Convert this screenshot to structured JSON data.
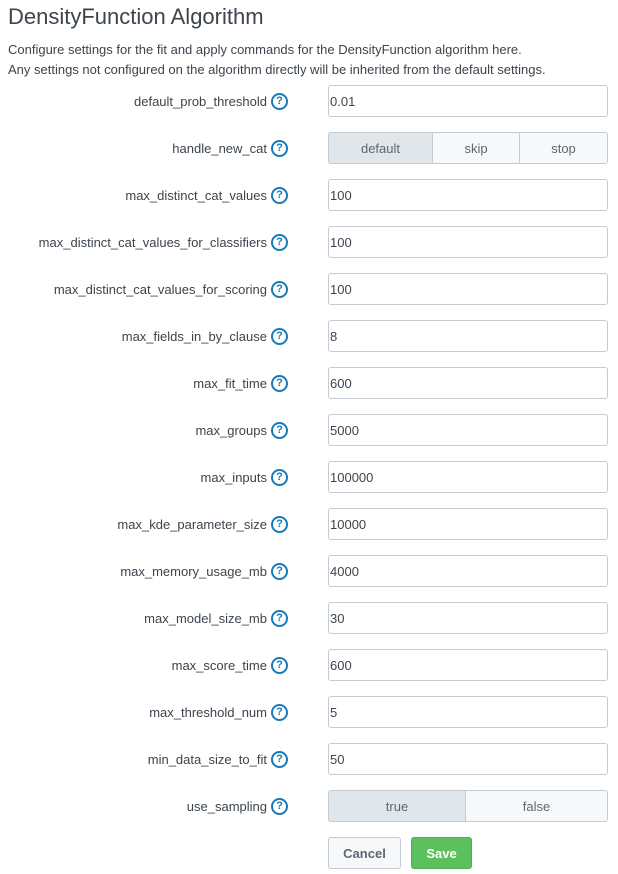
{
  "header": {
    "title": "DensityFunction Algorithm",
    "description_line1": "Configure settings for the fit and apply commands for the DensityFunction algorithm here.",
    "description_line2": "Any settings not configured on the algorithm directly will be inherited from the default settings."
  },
  "help_icon_glyph": "?",
  "settings": [
    {
      "label": "default_prob_threshold",
      "type": "text",
      "value": "0.01"
    },
    {
      "label": "handle_new_cat",
      "type": "segmented",
      "options": [
        "default",
        "skip",
        "stop"
      ],
      "selected": "default"
    },
    {
      "label": "max_distinct_cat_values",
      "type": "text",
      "value": "100"
    },
    {
      "label": "max_distinct_cat_values_for_classifiers",
      "type": "text",
      "value": "100"
    },
    {
      "label": "max_distinct_cat_values_for_scoring",
      "type": "text",
      "value": "100"
    },
    {
      "label": "max_fields_in_by_clause",
      "type": "text",
      "value": "8"
    },
    {
      "label": "max_fit_time",
      "type": "text",
      "value": "600"
    },
    {
      "label": "max_groups",
      "type": "text",
      "value": "5000"
    },
    {
      "label": "max_inputs",
      "type": "text",
      "value": "100000"
    },
    {
      "label": "max_kde_parameter_size",
      "type": "text",
      "value": "10000"
    },
    {
      "label": "max_memory_usage_mb",
      "type": "text",
      "value": "4000"
    },
    {
      "label": "max_model_size_mb",
      "type": "text",
      "value": "30"
    },
    {
      "label": "max_score_time",
      "type": "text",
      "value": "600"
    },
    {
      "label": "max_threshold_num",
      "type": "text",
      "value": "5"
    },
    {
      "label": "min_data_size_to_fit",
      "type": "text",
      "value": "50"
    },
    {
      "label": "use_sampling",
      "type": "segmented",
      "options": [
        "true",
        "false"
      ],
      "selected": "true"
    }
  ],
  "actions": {
    "cancel_label": "Cancel",
    "save_label": "Save"
  },
  "colors": {
    "accent_help": "#1a7ab8",
    "save_green": "#5cc05c",
    "segment_active": "#e1e6eb"
  }
}
